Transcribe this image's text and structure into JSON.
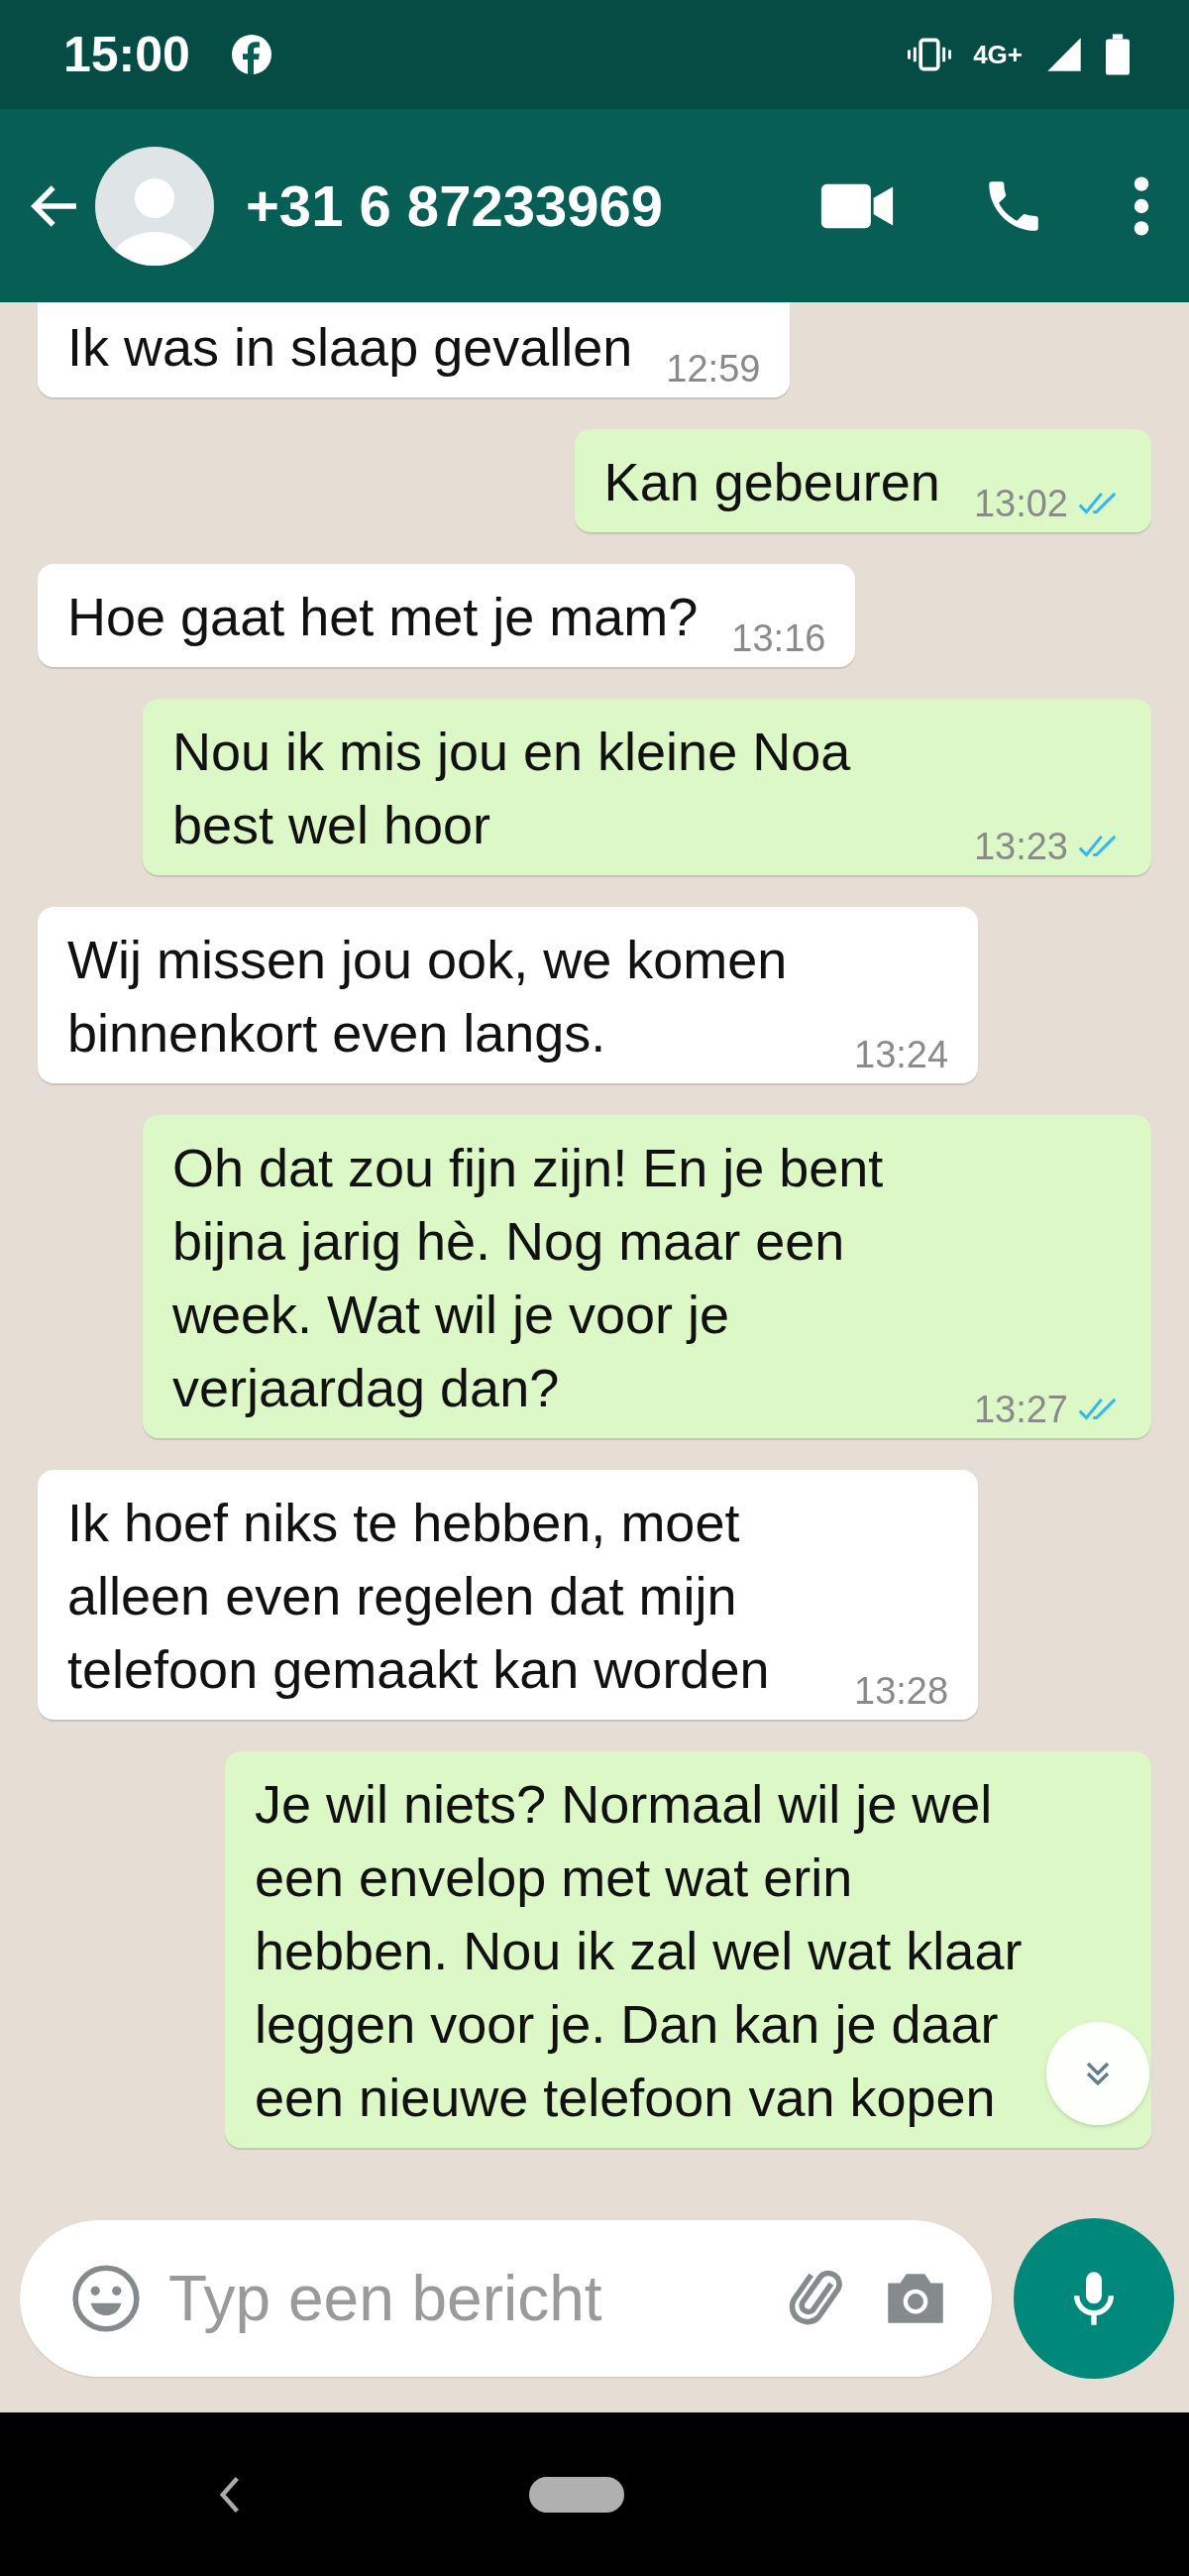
{
  "status_bar": {
    "time": "15:00",
    "network": "4G+"
  },
  "header": {
    "contact": "+31 6 87233969"
  },
  "messages": [
    {
      "kind": "received",
      "text": "Ik was in slaap gevallen",
      "time": "12:59"
    },
    {
      "kind": "sent",
      "text": "Kan gebeuren",
      "time": "13:02",
      "read": true
    },
    {
      "kind": "received",
      "text": "Hoe gaat het met je mam?",
      "time": "13:16"
    },
    {
      "kind": "sent",
      "text": "Nou ik mis jou en kleine Noa best wel hoor",
      "time": "13:23",
      "read": true
    },
    {
      "kind": "received",
      "text": "Wij missen jou ook, we komen binnenkort even langs.",
      "time": "13:24"
    },
    {
      "kind": "sent",
      "text": "Oh dat zou fijn zijn! En je bent bijna jarig hè. Nog maar een week. Wat wil je voor je verjaardag dan?",
      "time": "13:27",
      "read": true
    },
    {
      "kind": "received",
      "text": "Ik hoef niks te hebben, moet alleen even regelen dat mijn telefoon gemaakt kan worden",
      "time": "13:28"
    },
    {
      "kind": "sent",
      "text": "Je wil niets? Normaal wil je wel een envelop met wat erin hebben. Nou ik zal wel wat klaar leggen voor je. Dan kan je daar een nieuwe telefoon van kopen"
    }
  ],
  "composer": {
    "placeholder": "Typ een bericht"
  }
}
